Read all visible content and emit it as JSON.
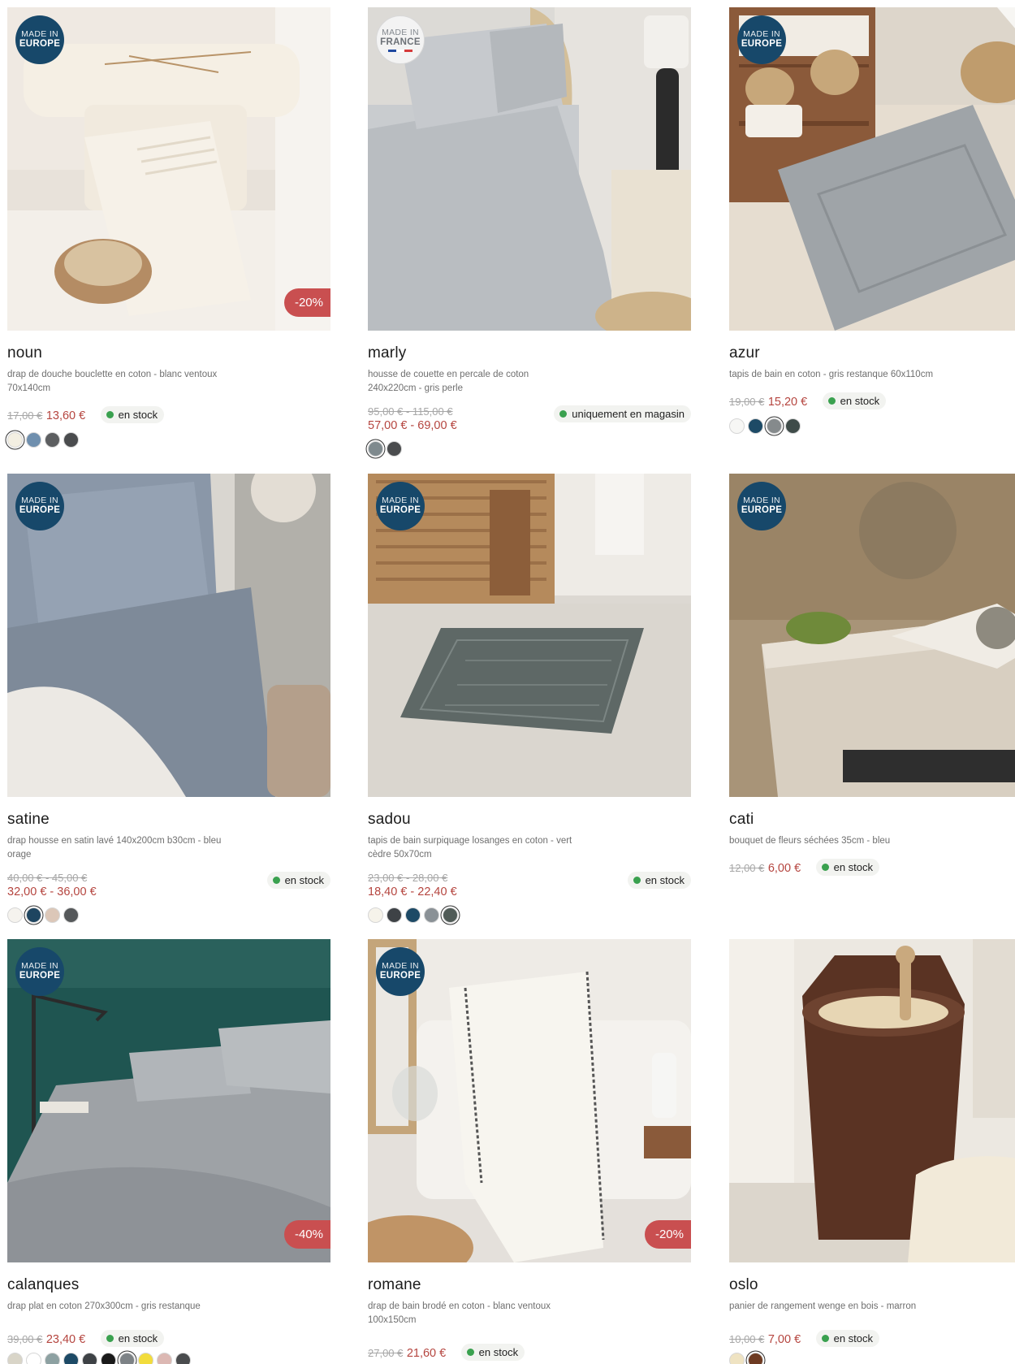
{
  "products": [
    {
      "name": "noun",
      "description": "drap de douche bouclette en coton - blanc ventoux 70x140cm",
      "badge": {
        "line1": "MADE IN",
        "line2": "EUROPE",
        "type": "europe"
      },
      "discount": "-20%",
      "old_price": "17,00 €",
      "new_price": "13,60 €",
      "stock": "en stock",
      "swatches": [
        "#f3efe2",
        "#6f8fae",
        "#5c5e60",
        "#4a4c4e"
      ],
      "selected": 0
    },
    {
      "name": "marly",
      "description": "housse de couette en percale de coton 240x220cm - gris perle",
      "badge": {
        "line1": "MADE IN",
        "line2": "FRANCE",
        "type": "france"
      },
      "old_price": "95,00 € - 115,00 €",
      "new_price": "57,00 € - 69,00 €",
      "stock": "uniquement en magasin",
      "swatches": [
        "#7f8a8e",
        "#4a4c4e"
      ],
      "selected": 0
    },
    {
      "name": "azur",
      "description": "tapis de bain en coton - gris restanque 60x110cm",
      "badge": {
        "line1": "MADE IN",
        "line2": "EUROPE",
        "type": "europe"
      },
      "old_price": "19,00 €",
      "new_price": "15,20 €",
      "stock": "en stock",
      "swatches": [
        "#f7f7f5",
        "#1d4a66",
        "#858a8c",
        "#3f4c49"
      ],
      "selected": 2
    },
    {
      "name": "satine",
      "description": "drap housse en satin lavé 140x200cm b30cm - bleu orage",
      "badge": {
        "line1": "MADE IN",
        "line2": "EUROPE",
        "type": "europe"
      },
      "old_price": "40,00 € - 45,00 €",
      "new_price": "32,00 € - 36,00 €",
      "stock": "en stock",
      "swatches": [
        "#f5f3ee",
        "#1e4560",
        "#dcc7b8",
        "#55585a"
      ],
      "selected": 1
    },
    {
      "name": "sadou",
      "description": "tapis de bain surpiquage losanges en coton - vert cèdre 50x70cm",
      "badge": {
        "line1": "MADE IN",
        "line2": "EUROPE",
        "type": "europe"
      },
      "old_price": "23,00 € - 28,00 €",
      "new_price": "18,40 € - 22,40 €",
      "stock": "en stock",
      "swatches": [
        "#f6f3ea",
        "#3e4246",
        "#1d4a66",
        "#8a9196",
        "#505b57"
      ],
      "selected": 4
    },
    {
      "name": "cati",
      "description": "bouquet de fleurs séchées 35cm - bleu",
      "badge": {
        "line1": "MADE IN",
        "line2": "EUROPE",
        "type": "europe"
      },
      "old_price": "12,00 €",
      "new_price": "6,00 €",
      "stock": "en stock",
      "swatches": [],
      "selected": -1
    },
    {
      "name": "calanques",
      "description": "drap plat en coton 270x300cm - gris restanque",
      "badge": {
        "line1": "MADE IN",
        "line2": "EUROPE",
        "type": "europe"
      },
      "discount": "-40%",
      "old_price": "39,00 €",
      "new_price": "23,40 €",
      "stock": "en stock",
      "swatches": [
        "#d9d5c8",
        "#ffffff",
        "#8da1a2",
        "#1d4a66",
        "#3e4246",
        "#1a1a1a",
        "#7d8286",
        "#f2dc3c",
        "#dcb8b3",
        "#4a4c4e"
      ],
      "selected": 6
    },
    {
      "name": "romane",
      "description": "drap de bain brodé en coton - blanc ventoux 100x150cm",
      "badge": {
        "line1": "MADE IN",
        "line2": "EUROPE",
        "type": "europe"
      },
      "discount": "-20%",
      "old_price": "27,00 €",
      "new_price": "21,60 €",
      "stock": "en stock",
      "swatches": [],
      "selected": -1
    },
    {
      "name": "oslo",
      "description": "panier de rangement wenge en bois - marron",
      "old_price": "10,00 €",
      "new_price": "7,00 €",
      "stock": "en stock",
      "swatches": [
        "#efe3c2",
        "#6e3b22"
      ],
      "selected": 1
    }
  ],
  "colors": {
    "accent_price": "#b5453f",
    "discount_badge": "#c94f50",
    "europe_badge": "#17486a",
    "stock_dot": "#3aa14f"
  }
}
